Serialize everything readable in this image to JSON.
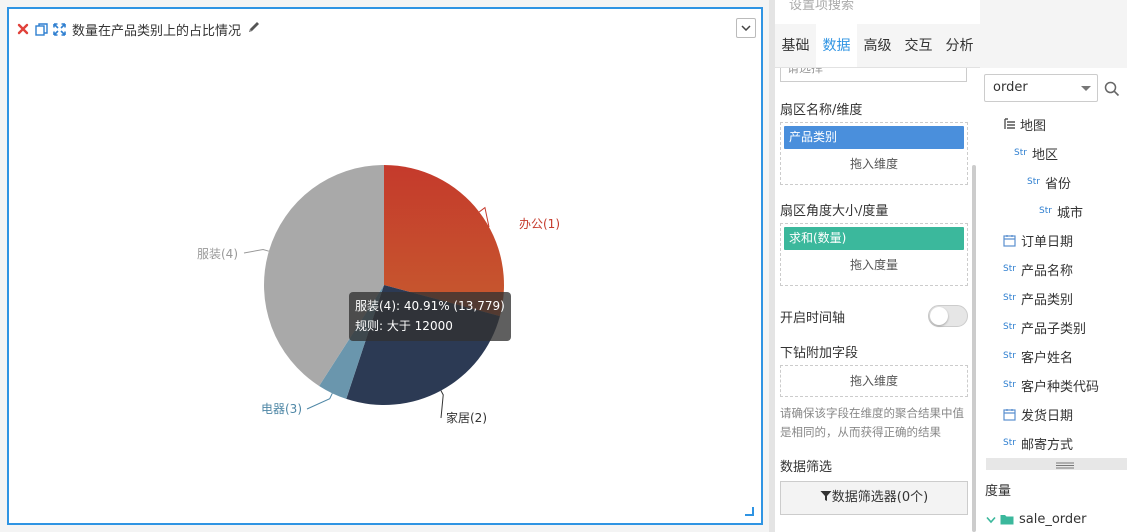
{
  "widget": {
    "title": "数量在产品类别上的占比情况",
    "tooltip_line1": "服装(4): 40.91% (13,779)",
    "tooltip_line2": "规则: 大于 12000"
  },
  "chart_data": {
    "type": "pie",
    "title": "数量在产品类别上的占比情况",
    "categories": [
      "办公(1)",
      "家居(2)",
      "电器(3)",
      "服装(4)"
    ],
    "values": [
      0.2917,
      0.2592,
      0.04,
      0.4091
    ],
    "colors": [
      "#c53a2c",
      "#2c3a54",
      "#6a96ad",
      "#a9a9a9"
    ],
    "label_colors": [
      "#c53a2c",
      "#333333",
      "#4f87a6",
      "#999999"
    ]
  },
  "panel": {
    "search_placeholder": "设置项搜索",
    "tabs": [
      "基础",
      "数据",
      "高级",
      "交互",
      "分析"
    ],
    "select_partial": "请选择",
    "sector_dim_label": "扇区名称/维度",
    "sector_dim_value": "产品类别",
    "drag_dim_hint": "拖入维度",
    "sector_measure_label": "扇区角度大小/度量",
    "sector_measure_value": "求和(数量)",
    "drag_measure_hint": "拖入度量",
    "timeline_label": "开启时间轴",
    "drill_label": "下钻附加字段",
    "drill_hint": "拖入维度",
    "drill_note": "请确保该字段在维度的聚合结果中值是相同的，从而获得正确的结果",
    "filter_label": "数据筛选",
    "filter_button": "数据筛选器(0个)"
  },
  "fields": {
    "datasource": "order",
    "items": [
      {
        "tag": "",
        "label": "地图"
      },
      {
        "tag": "Str",
        "label": "地区"
      },
      {
        "tag": "Str",
        "label": "省份"
      },
      {
        "tag": "Str",
        "label": "城市"
      },
      {
        "tag": "",
        "label": "订单日期"
      },
      {
        "tag": "Str",
        "label": "产品名称"
      },
      {
        "tag": "Str",
        "label": "产品类别"
      },
      {
        "tag": "Str",
        "label": "产品子类别"
      },
      {
        "tag": "Str",
        "label": "客户姓名"
      },
      {
        "tag": "Str",
        "label": "客户种类代码"
      },
      {
        "tag": "",
        "label": "发货日期"
      },
      {
        "tag": "Str",
        "label": "邮寄方式"
      }
    ],
    "measure_label": "度量",
    "measure_group": "sale_order"
  }
}
